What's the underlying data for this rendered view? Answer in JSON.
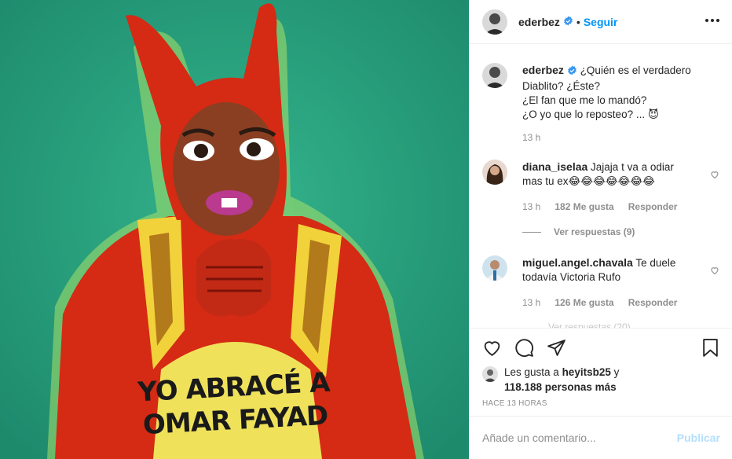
{
  "post": {
    "image_caption_text": [
      "YO ABRACÉ A",
      "OMAR FAYAD"
    ],
    "colors": {
      "background": "#27a07f",
      "costume": "#d52a14",
      "vest": "#f2d23a",
      "shirt": "#efe25a"
    }
  },
  "header": {
    "username": "ederbez",
    "separator": "•",
    "follow_label": "Seguir"
  },
  "caption": {
    "username": "ederbez",
    "lines": [
      "¿Quién es el verdadero",
      "Diablito? ¿Éste?",
      "¿El fan que me lo mandó?",
      "¿O yo que lo reposteo? ... 😈"
    ],
    "time": "13 h"
  },
  "comments": [
    {
      "username": "diana_iselaa",
      "text_line1": "Jajaja t va a odiar",
      "text_line2": "mas tu ex😂😂😂😂😂😂😂",
      "time": "13 h",
      "likes": "182 Me gusta",
      "reply_label": "Responder",
      "view_replies": "Ver respuestas (9)"
    },
    {
      "username": "miguel.angel.chavala",
      "text_line1": "Te duele",
      "text_line2": "todavía Victoria Rufo",
      "time": "13 h",
      "likes": "126 Me gusta",
      "reply_label": "Responder",
      "view_replies": "Ver respuestas (20)"
    }
  ],
  "likes": {
    "prefix": "Les gusta a ",
    "user": "heyitsb25",
    "suffix": " y",
    "count": "118.188 personas más"
  },
  "timestamp": "Hace 13 horas",
  "add_comment": {
    "placeholder": "Añade un comentario...",
    "publish_label": "Publicar"
  },
  "icons": {
    "like": "heart-icon",
    "comment": "comment-icon",
    "share": "share-icon",
    "save": "bookmark-icon",
    "more": "more-icon",
    "verified": "verified-badge-icon"
  },
  "accent_color": "#0095f6"
}
